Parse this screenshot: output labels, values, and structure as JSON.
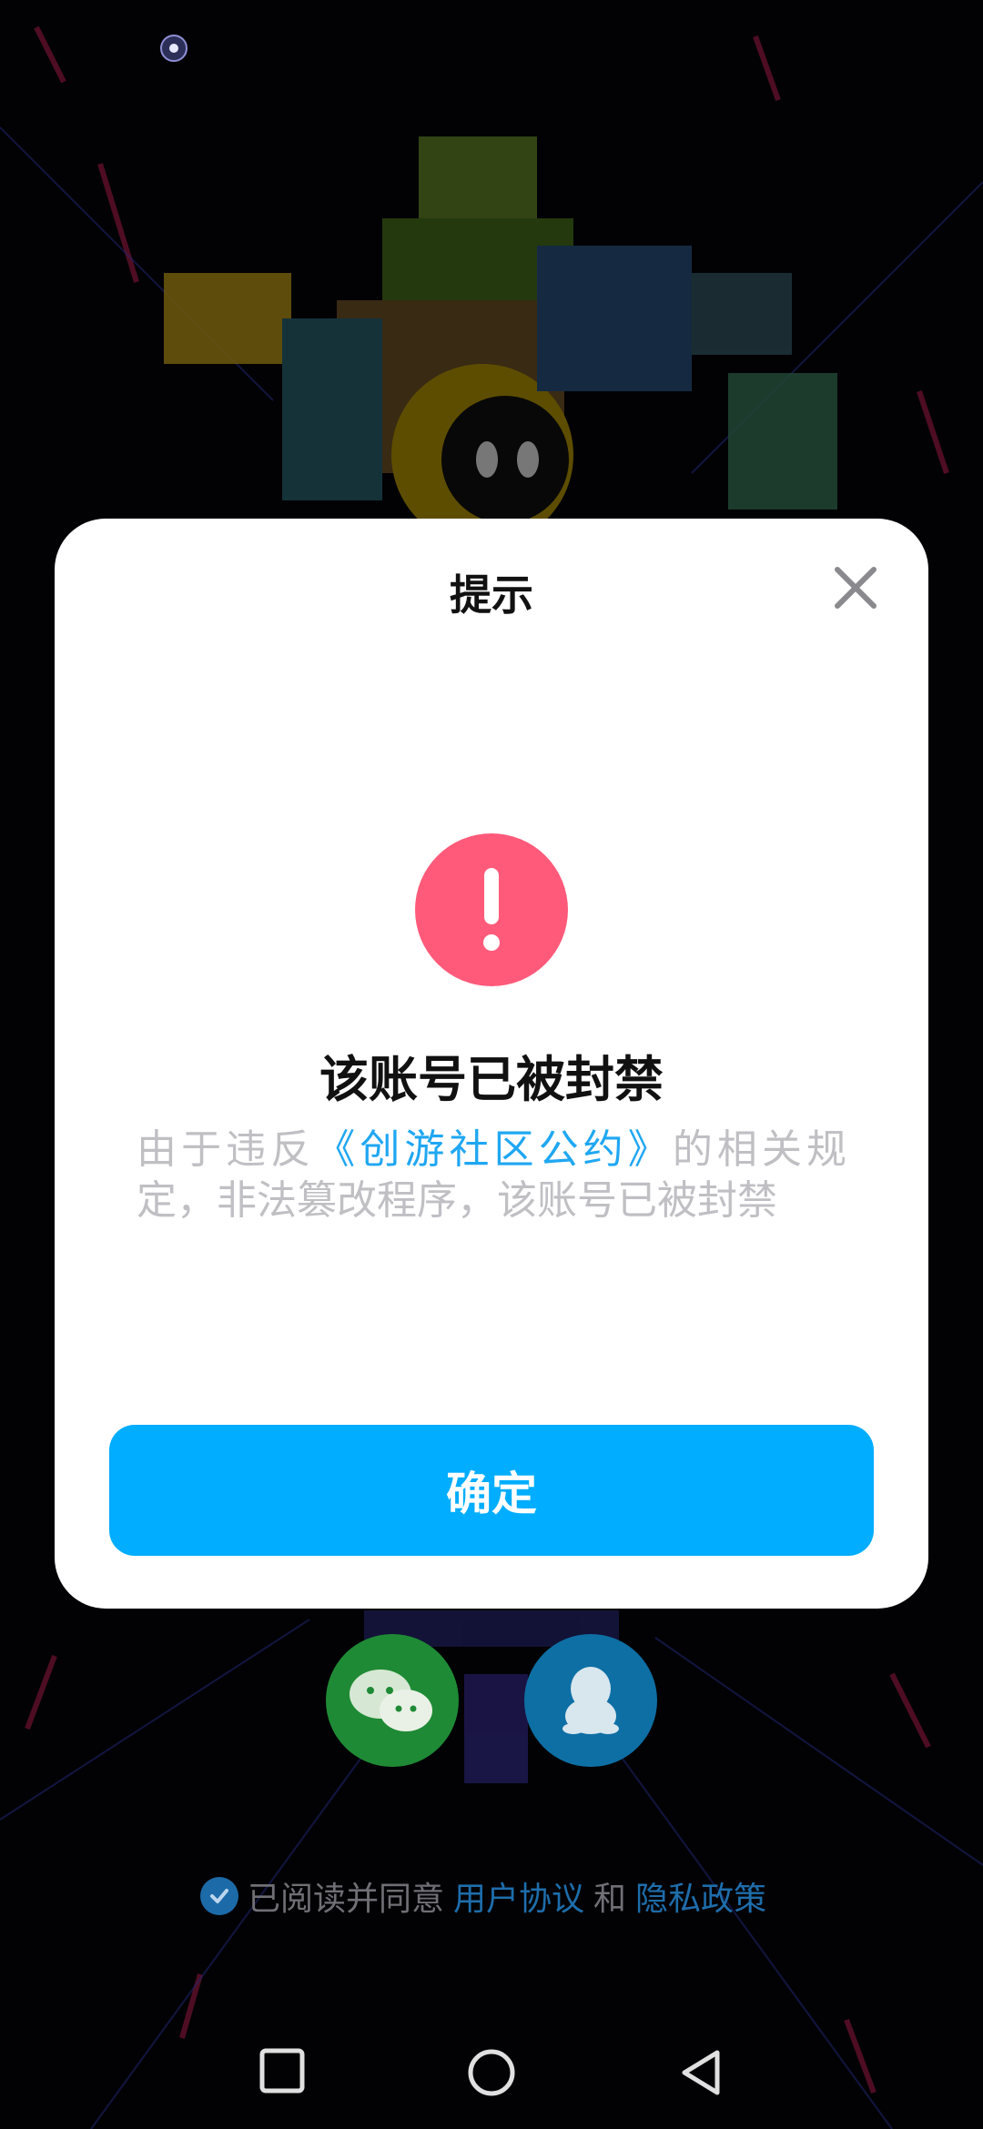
{
  "dialog": {
    "title": "提示",
    "headline": "该账号已被封禁",
    "message_prefix": "由于违反",
    "message_link": "《创游社区公约》",
    "message_suffix": "的相关规定，非法篡改程序，该账号已被封禁",
    "confirm_label": "确定",
    "close_icon": "close-icon",
    "alert_icon": "exclamation-icon"
  },
  "login": {
    "wechat_icon": "wechat-icon",
    "qq_icon": "qq-icon"
  },
  "agreement": {
    "text": "已阅读并同意",
    "user_agreement": "用户协议",
    "and": "和",
    "privacy_policy": "隐私政策",
    "checked": true
  },
  "colors": {
    "accent": "#00adff",
    "alert": "#ff5a7a",
    "link": "#1fa7f2"
  }
}
